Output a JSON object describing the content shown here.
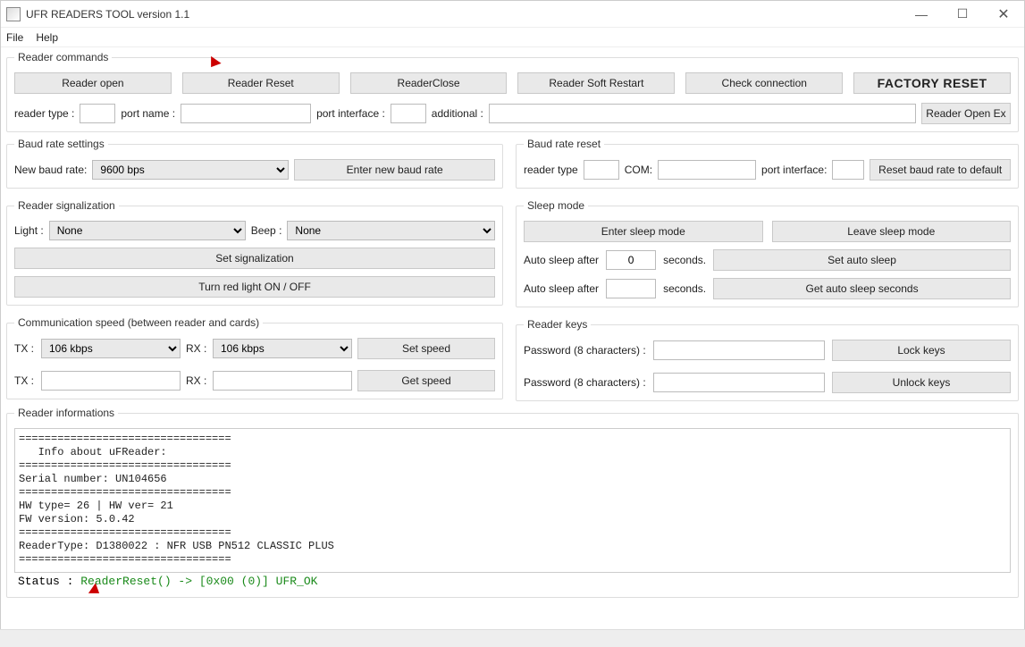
{
  "window": {
    "title": "UFR READERS TOOL version 1.1"
  },
  "menu": {
    "file": "File",
    "help": "Help"
  },
  "reader_commands": {
    "legend": "Reader commands",
    "reader_open": "Reader open",
    "reader_reset": "Reader Reset",
    "reader_close": "ReaderClose",
    "reader_soft_restart": "Reader Soft Restart",
    "check_connection": "Check connection",
    "factory_reset": "FACTORY RESET",
    "reader_type_label": "reader type :",
    "port_name_label": "port name :",
    "port_interface_label": "port interface :",
    "additional_label": "additional :",
    "reader_open_ex": "Reader Open Ex"
  },
  "baud_settings": {
    "legend": "Baud rate settings",
    "new_baud_label": "New baud rate:",
    "selected": "9600 bps",
    "enter_btn": "Enter new baud rate"
  },
  "baud_reset": {
    "legend": "Baud rate reset",
    "reader_type_label": "reader type",
    "com_label": "COM:",
    "port_interface_label": "port interface:",
    "reset_btn": "Reset baud rate to default"
  },
  "signalization": {
    "legend": "Reader signalization",
    "light_label": "Light :",
    "light_value": "None",
    "beep_label": "Beep :",
    "beep_value": "None",
    "set_btn": "Set signalization",
    "red_btn": "Turn red light ON / OFF"
  },
  "sleep": {
    "legend": "Sleep mode",
    "enter": "Enter sleep mode",
    "leave": "Leave sleep mode",
    "auto_label": "Auto sleep after",
    "seconds_label": "seconds.",
    "set_auto": "Set auto sleep",
    "get_auto": "Get auto sleep seconds",
    "auto_value": "0"
  },
  "comm_speed": {
    "legend": "Communication speed (between reader and cards)",
    "tx_label": "TX :",
    "rx_label": "RX :",
    "tx_value": "106 kbps",
    "rx_value": "106 kbps",
    "set_btn": "Set speed",
    "get_btn": "Get speed"
  },
  "reader_keys": {
    "legend": "Reader keys",
    "pwd_label": "Password (8 characters) :",
    "lock": "Lock keys",
    "unlock": "Unlock keys"
  },
  "reader_info": {
    "legend": "Reader informations",
    "text": "=================================\n   Info about uFReader:\n=================================\nSerial number: UN104656\n=================================\nHW type= 26 | HW ver= 21\nFW version: 5.0.42\n=================================\nReaderType: D1380022 : NFR USB PN512 CLASSIC PLUS\n=================================",
    "status_label": "Status : ",
    "status_value": "ReaderReset() -> [0x00 (0)] UFR_OK"
  }
}
